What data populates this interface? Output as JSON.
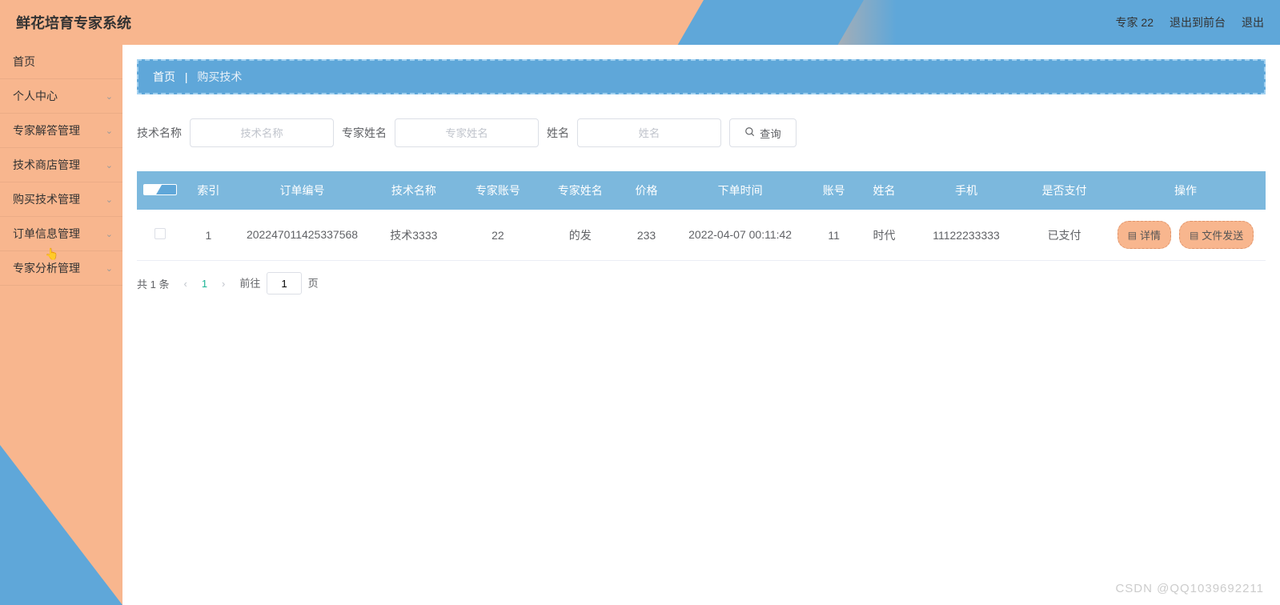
{
  "header": {
    "title": "鲜花培育专家系统",
    "user_label": "专家 22",
    "exit_front": "退出到前台",
    "logout": "退出"
  },
  "sidebar": {
    "items": [
      {
        "label": "首页",
        "expandable": false
      },
      {
        "label": "个人中心",
        "expandable": true
      },
      {
        "label": "专家解答管理",
        "expandable": true
      },
      {
        "label": "技术商店管理",
        "expandable": true
      },
      {
        "label": "购买技术管理",
        "expandable": true
      },
      {
        "label": "订单信息管理",
        "expandable": true
      },
      {
        "label": "专家分析管理",
        "expandable": true
      }
    ]
  },
  "breadcrumb": {
    "home": "首页",
    "current": "购买技术"
  },
  "search": {
    "tech_name_label": "技术名称",
    "tech_name_placeholder": "技术名称",
    "expert_name_label": "专家姓名",
    "expert_name_placeholder": "专家姓名",
    "name_label": "姓名",
    "name_placeholder": "姓名",
    "query_btn": "查询"
  },
  "table": {
    "headers": [
      "索引",
      "订单编号",
      "技术名称",
      "专家账号",
      "专家姓名",
      "价格",
      "下单时间",
      "账号",
      "姓名",
      "手机",
      "是否支付",
      "操作"
    ],
    "rows": [
      {
        "index": "1",
        "order_no": "202247011425337568",
        "tech_name": "技术3333",
        "expert_account": "22",
        "expert_name": "的发",
        "price": "233",
        "order_time": "2022-04-07 00:11:42",
        "account": "11",
        "name": "时代",
        "phone": "11122233333",
        "paid": "已支付"
      }
    ],
    "actions": {
      "detail": "详情",
      "file_send": "文件发送"
    }
  },
  "pagination": {
    "total_text": "共 1 条",
    "current_page": "1",
    "goto_prefix": "前往",
    "goto_input": "1",
    "goto_suffix": "页"
  },
  "watermark": "CSDN @QQ1039692211"
}
